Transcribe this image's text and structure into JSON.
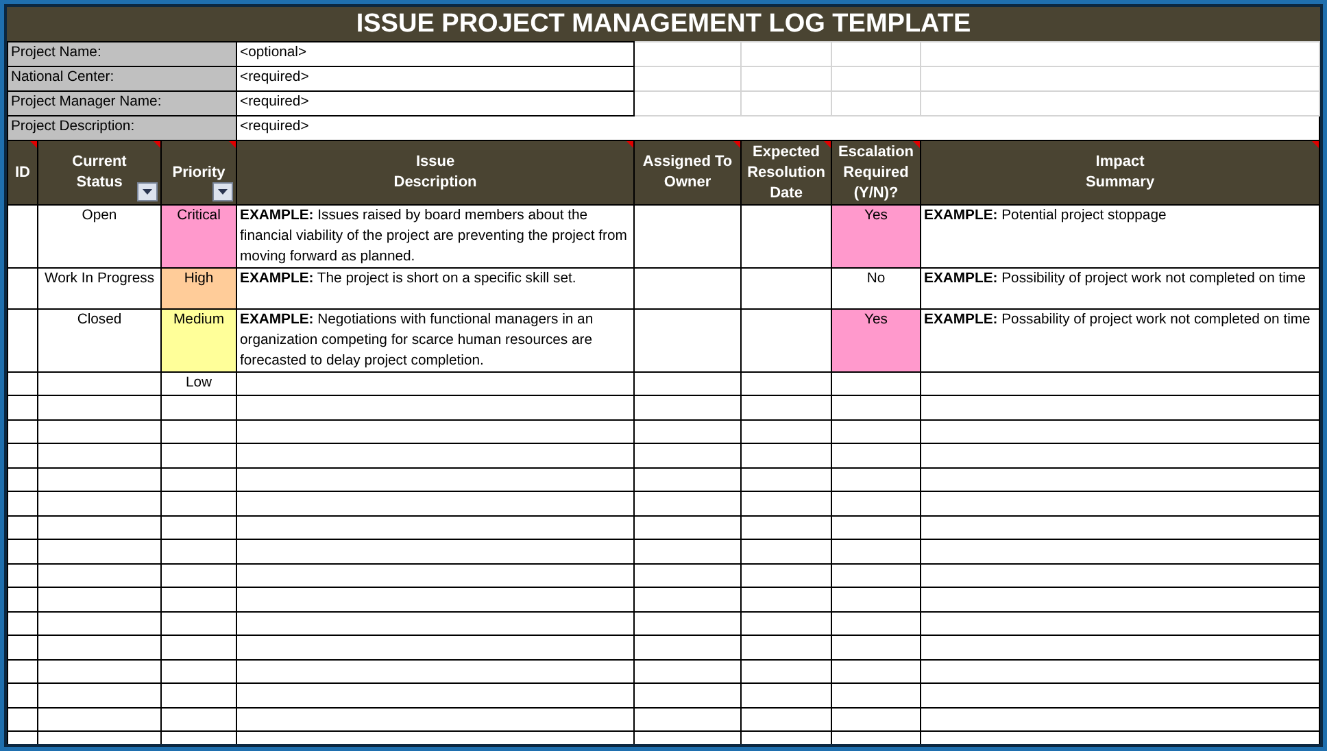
{
  "title": "ISSUE PROJECT MANAGEMENT LOG TEMPLATE",
  "project_info": [
    {
      "label": "Project Name:",
      "value": "<optional>"
    },
    {
      "label": "National Center:",
      "value": "<required>"
    },
    {
      "label": "Project Manager Name:",
      "value": "<required>"
    },
    {
      "label": "Project Description:",
      "value": "<required>",
      "wide": true
    }
  ],
  "table": {
    "columns": [
      {
        "label": "ID",
        "filter": false
      },
      {
        "label": "Current\nStatus",
        "filter": true
      },
      {
        "label": "Priority",
        "filter": true
      },
      {
        "label": "Issue\nDescription",
        "filter": false
      },
      {
        "label": "Assigned To\nOwner",
        "filter": false
      },
      {
        "label": "Expected\nResolution\nDate",
        "filter": false
      },
      {
        "label": "Escalation\nRequired\n(Y/N)?",
        "filter": false
      },
      {
        "label": "Impact\nSummary",
        "filter": false
      }
    ],
    "rows": [
      {
        "status": "Open",
        "priority": {
          "text": "Critical",
          "color": "#ff99cc"
        },
        "issue": "**EXAMPLE:** Issues raised by board members about the financial viability of the project are preventing the project from moving forward as planned.",
        "escalation": {
          "text": "Yes",
          "color": "#ff99cc"
        },
        "impact": "**EXAMPLE:** Potential project stoppage"
      },
      {
        "status": "Work In Progress",
        "priority": {
          "text": "High",
          "color": "#ffcc99"
        },
        "issue": "**EXAMPLE:** The project is short on a specific skill set.",
        "escalation": {
          "text": "No"
        },
        "impact": "**EXAMPLE:** Possibility of project work not completed on time"
      },
      {
        "status": "Closed",
        "priority": {
          "text": "Medium",
          "color": "#ffff99"
        },
        "issue": "**EXAMPLE:** Negotiations with functional managers in an organization competing for scarce human resources are forecasted to delay project completion.",
        "escalation": {
          "text": "Yes",
          "color": "#ff99cc"
        },
        "impact": "**EXAMPLE:** Possability of project work not completed on time"
      },
      {
        "priority": {
          "text": "Low"
        }
      }
    ]
  }
}
